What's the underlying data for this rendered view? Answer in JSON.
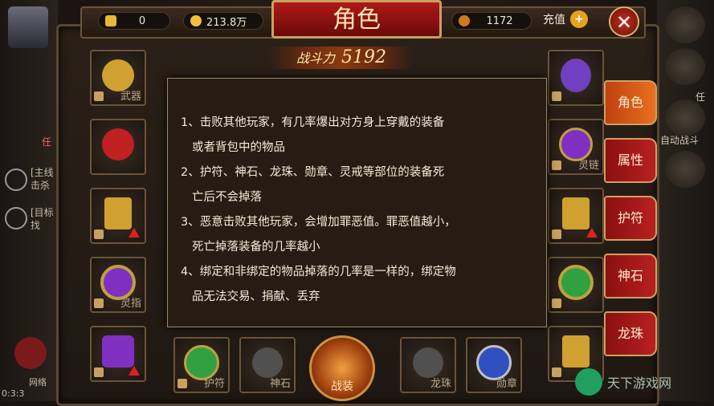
{
  "header": {
    "title": "角色",
    "resources": [
      {
        "value": "0",
        "icon": "gold-ingot-icon",
        "color": "#e8b830"
      },
      {
        "value": "213.8万",
        "icon": "gold-coin-icon",
        "color": "#f0c040"
      },
      {
        "value": "1172",
        "icon": "gem-icon",
        "color": "#d07820"
      }
    ],
    "recharge_label": "充值",
    "plus_symbol": "+",
    "close_symbol": "✕"
  },
  "power": {
    "label": "战斗力",
    "value": "5192"
  },
  "info_box": {
    "lines": [
      "1、击败其他玩家，有几率爆出对方身上穿戴的装备",
      "或者背包中的物品",
      "2、护符、神石、龙珠、勋章、灵戒等部位的装备死",
      "亡后不会掉落",
      "3、恶意击败其他玩家，会增加罪恶值。罪恶值越小，",
      "死亡掉落装备的几率越小",
      "4、绑定和非绑定的物品掉落的几率是一样的，绑定物",
      "品无法交易、捐献、丢弃"
    ]
  },
  "left_slots": [
    {
      "label": "武器",
      "gem_color": "#d0a030"
    },
    {
      "label": "",
      "gem_color": "#c02020"
    },
    {
      "label": "",
      "gem_color": "#d0a030"
    },
    {
      "label": "灵指",
      "gem_color": "#8030c0"
    },
    {
      "label": "",
      "gem_color": "#8030c0"
    }
  ],
  "right_slots": [
    {
      "label": "",
      "gem_color": "#7040c0"
    },
    {
      "label": "灵链",
      "gem_color": "#8030c0"
    },
    {
      "label": "",
      "gem_color": "#d0a030"
    },
    {
      "label": "",
      "gem_color": "#30a040"
    },
    {
      "label": "",
      "gem_color": "#d0a030"
    }
  ],
  "bottom_slots": [
    {
      "label": "护符",
      "gem_color": "#30a040"
    },
    {
      "label": "神石",
      "gem_color": "#606060"
    },
    {
      "label": "龙珠",
      "gem_color": "#606060"
    },
    {
      "label": "勋章",
      "gem_color": "#3050c0"
    }
  ],
  "center_slot": {
    "label": "战装"
  },
  "tabs": [
    {
      "label": "角色",
      "active": true
    },
    {
      "label": "属性",
      "active": false
    },
    {
      "label": "护符",
      "active": false
    },
    {
      "label": "神石",
      "active": false
    },
    {
      "label": "龙珠",
      "active": false
    }
  ],
  "left_panel": {
    "tag": "任",
    "quest1_a": "[主线",
    "quest1_b": "击杀",
    "quest2_a": "[目标",
    "quest2_b": "找",
    "network_label": "网络",
    "time": "0:3:3"
  },
  "right_panel": {
    "label1": "任",
    "label2": "自动战斗"
  },
  "watermark": "天下游戏网"
}
